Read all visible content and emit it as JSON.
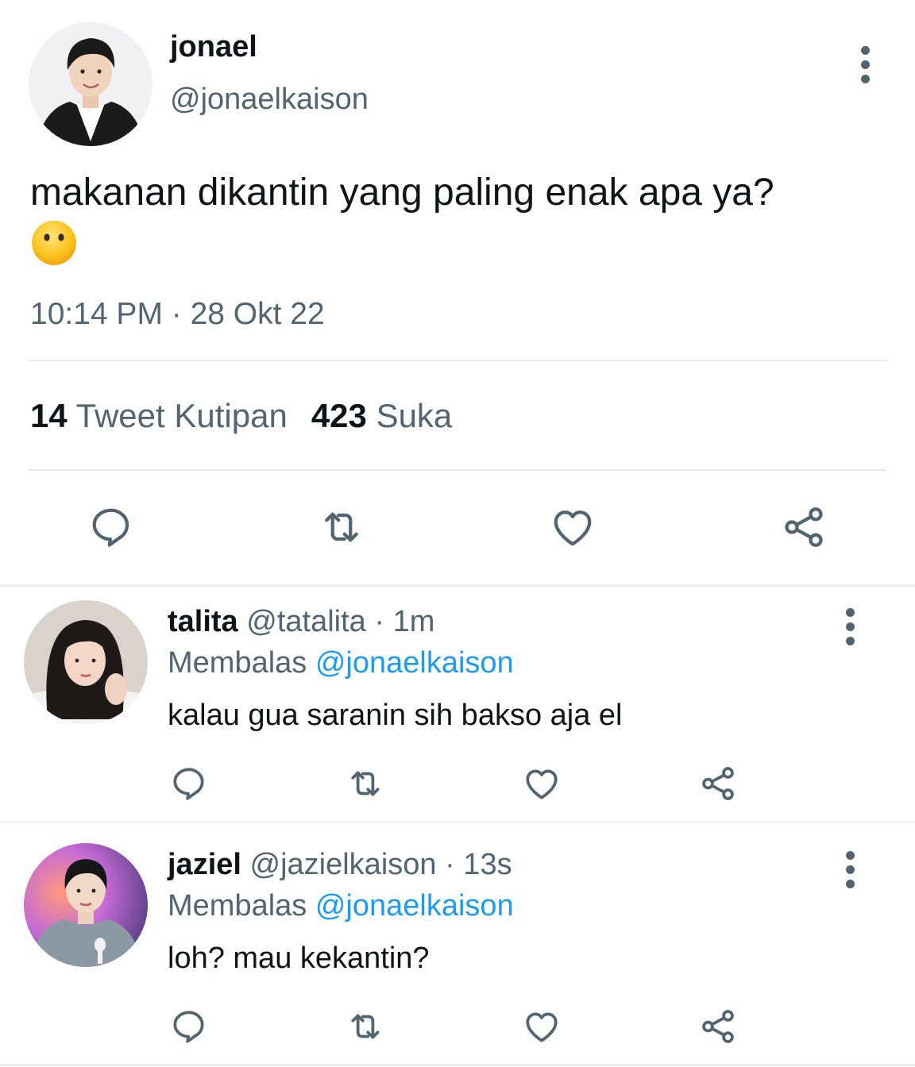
{
  "main_tweet": {
    "author_name": "jonael",
    "author_handle": "@jonaelkaison",
    "text": "makanan dikantin yang paling enak apa ya?",
    "emoji": "neutral-face-no-mouth",
    "timestamp": "10:14 PM · 28 Okt 22",
    "stats": {
      "quote_count": "14",
      "quote_label": "Tweet Kutipan",
      "like_count": "423",
      "like_label": "Suka"
    },
    "actions": [
      "reply-icon",
      "retweet-icon",
      "heart-icon",
      "share-icon"
    ]
  },
  "replies": [
    {
      "name": "talita",
      "handle": "@tatalita",
      "time": "· 1m",
      "replying_label": "Membalas",
      "replying_to": "@jonaelkaison",
      "text": "kalau gua saranin sih bakso aja el"
    },
    {
      "name": "jaziel",
      "handle": "@jazielkaison",
      "time": "· 13s",
      "replying_label": "Membalas",
      "replying_to": "@jonaelkaison",
      "text": "loh? mau kekantin?"
    }
  ],
  "colors": {
    "text_primary": "#0f1419",
    "text_secondary": "#536471",
    "link": "#1d9bf0",
    "divider": "#e7e9ea"
  }
}
